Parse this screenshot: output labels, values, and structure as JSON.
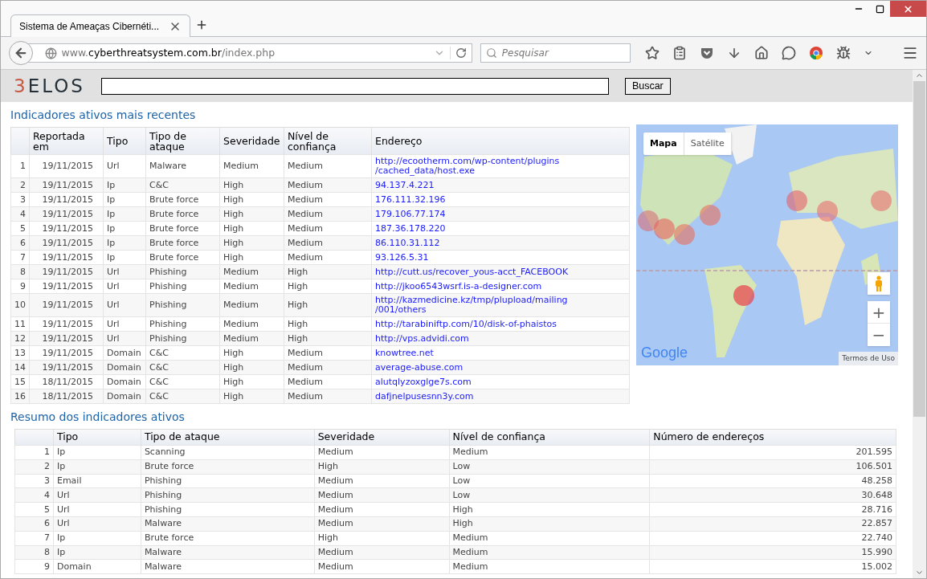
{
  "browser": {
    "tab_title": "Sistema de Ameaças Cibernéti...",
    "url_host_prefix": "www.",
    "url_domain": "cyberthreatsystem.com.br",
    "url_path": "/index.php",
    "search_placeholder": "Pesquisar"
  },
  "header": {
    "logo_number": "3",
    "logo_word": "ELOS",
    "search_button": "Buscar"
  },
  "recent": {
    "title": "Indicadores ativos mais recentes",
    "columns": [
      "",
      "Reportada em",
      "Tipo",
      "Tipo de ataque",
      "Severidade",
      "Nível de confiança",
      "Endereço"
    ],
    "rows": [
      [
        "1",
        "19/11/2015",
        "Url",
        "Malware",
        "Medium",
        "Medium",
        "http://ecootherm.com/wp-content/plugins /cached_data/host.exe"
      ],
      [
        "2",
        "19/11/2015",
        "Ip",
        "C&C",
        "High",
        "Medium",
        "94.137.4.221"
      ],
      [
        "3",
        "19/11/2015",
        "Ip",
        "Brute force",
        "High",
        "Medium",
        "176.111.32.196"
      ],
      [
        "4",
        "19/11/2015",
        "Ip",
        "Brute force",
        "High",
        "Medium",
        "179.106.77.174"
      ],
      [
        "5",
        "19/11/2015",
        "Ip",
        "Brute force",
        "High",
        "Medium",
        "187.36.178.220"
      ],
      [
        "6",
        "19/11/2015",
        "Ip",
        "Brute force",
        "High",
        "Medium",
        "86.110.31.112"
      ],
      [
        "7",
        "19/11/2015",
        "Ip",
        "Brute force",
        "High",
        "Medium",
        "93.126.5.31"
      ],
      [
        "8",
        "19/11/2015",
        "Url",
        "Phishing",
        "Medium",
        "High",
        "http://cutt.us/recover_yous-acct_FACEBOOK"
      ],
      [
        "9",
        "19/11/2015",
        "Url",
        "Phishing",
        "Medium",
        "High",
        "http://jkoo6543wsrf.is-a-designer.com"
      ],
      [
        "10",
        "19/11/2015",
        "Url",
        "Phishing",
        "Medium",
        "High",
        "http://kazmedicine.kz/tmp/plupload/mailing /001/others"
      ],
      [
        "11",
        "19/11/2015",
        "Url",
        "Phishing",
        "Medium",
        "High",
        "http://tarabiniftp.com/10/disk-of-phaistos"
      ],
      [
        "12",
        "19/11/2015",
        "Url",
        "Phishing",
        "Medium",
        "High",
        "http://vps.advidi.com"
      ],
      [
        "13",
        "19/11/2015",
        "Domain",
        "C&C",
        "High",
        "Medium",
        "knowtree.net"
      ],
      [
        "14",
        "19/11/2015",
        "Domain",
        "C&C",
        "High",
        "Medium",
        "average-abuse.com"
      ],
      [
        "15",
        "18/11/2015",
        "Domain",
        "C&C",
        "High",
        "Medium",
        "alutqlyzoxglge7s.com"
      ],
      [
        "16",
        "18/11/2015",
        "Domain",
        "C&C",
        "High",
        "Medium",
        "dafjnelpusesnn3y.com"
      ]
    ]
  },
  "map": {
    "kind": "picture",
    "types": [
      {
        "label": "Mapa",
        "selected": true
      },
      {
        "label": "Satélite",
        "selected": false
      }
    ],
    "zoom_in": "+",
    "zoom_out": "−",
    "logo": "Google",
    "terms": "Termos de Uso"
  },
  "summary": {
    "title": "Resumo dos indicadores ativos",
    "columns": [
      "",
      "Tipo",
      "Tipo de ataque",
      "Severidade",
      "Nível de confiança",
      "Número de endereços"
    ],
    "rows": [
      [
        "1",
        "Ip",
        "Scanning",
        "Medium",
        "Medium",
        "201.595"
      ],
      [
        "2",
        "Ip",
        "Brute force",
        "High",
        "Low",
        "106.501"
      ],
      [
        "3",
        "Email",
        "Phishing",
        "Medium",
        "Low",
        "48.258"
      ],
      [
        "4",
        "Url",
        "Phishing",
        "Medium",
        "Low",
        "30.648"
      ],
      [
        "5",
        "Url",
        "Phishing",
        "Medium",
        "High",
        "28.716"
      ],
      [
        "6",
        "Url",
        "Malware",
        "Medium",
        "High",
        "22.857"
      ],
      [
        "7",
        "Ip",
        "Brute force",
        "High",
        "Medium",
        "22.740"
      ],
      [
        "8",
        "Ip",
        "Malware",
        "Medium",
        "Medium",
        "15.990"
      ],
      [
        "9",
        "Domain",
        "Malware",
        "Medium",
        "Medium",
        "15.002"
      ]
    ]
  }
}
